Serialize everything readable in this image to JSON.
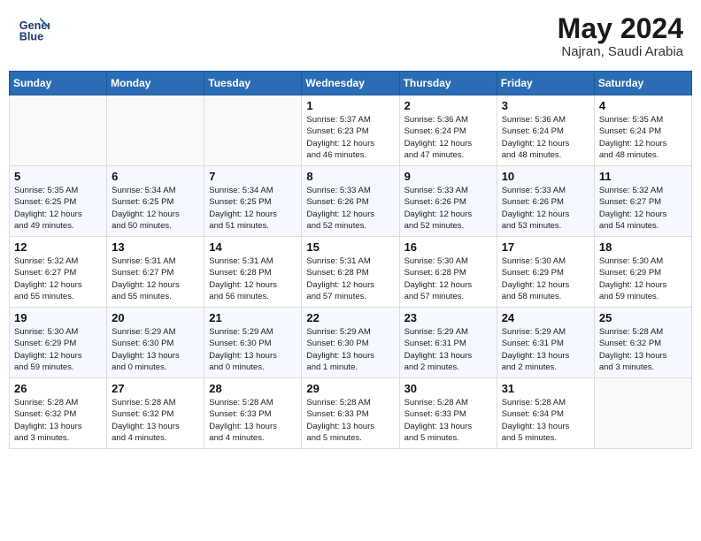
{
  "header": {
    "logo_line1": "General",
    "logo_line2": "Blue",
    "month_title": "May 2024",
    "subtitle": "Najran, Saudi Arabia"
  },
  "weekdays": [
    "Sunday",
    "Monday",
    "Tuesday",
    "Wednesday",
    "Thursday",
    "Friday",
    "Saturday"
  ],
  "weeks": [
    [
      {
        "day": "",
        "info": ""
      },
      {
        "day": "",
        "info": ""
      },
      {
        "day": "",
        "info": ""
      },
      {
        "day": "1",
        "info": "Sunrise: 5:37 AM\nSunset: 6:23 PM\nDaylight: 12 hours\nand 46 minutes."
      },
      {
        "day": "2",
        "info": "Sunrise: 5:36 AM\nSunset: 6:24 PM\nDaylight: 12 hours\nand 47 minutes."
      },
      {
        "day": "3",
        "info": "Sunrise: 5:36 AM\nSunset: 6:24 PM\nDaylight: 12 hours\nand 48 minutes."
      },
      {
        "day": "4",
        "info": "Sunrise: 5:35 AM\nSunset: 6:24 PM\nDaylight: 12 hours\nand 48 minutes."
      }
    ],
    [
      {
        "day": "5",
        "info": "Sunrise: 5:35 AM\nSunset: 6:25 PM\nDaylight: 12 hours\nand 49 minutes."
      },
      {
        "day": "6",
        "info": "Sunrise: 5:34 AM\nSunset: 6:25 PM\nDaylight: 12 hours\nand 50 minutes."
      },
      {
        "day": "7",
        "info": "Sunrise: 5:34 AM\nSunset: 6:25 PM\nDaylight: 12 hours\nand 51 minutes."
      },
      {
        "day": "8",
        "info": "Sunrise: 5:33 AM\nSunset: 6:26 PM\nDaylight: 12 hours\nand 52 minutes."
      },
      {
        "day": "9",
        "info": "Sunrise: 5:33 AM\nSunset: 6:26 PM\nDaylight: 12 hours\nand 52 minutes."
      },
      {
        "day": "10",
        "info": "Sunrise: 5:33 AM\nSunset: 6:26 PM\nDaylight: 12 hours\nand 53 minutes."
      },
      {
        "day": "11",
        "info": "Sunrise: 5:32 AM\nSunset: 6:27 PM\nDaylight: 12 hours\nand 54 minutes."
      }
    ],
    [
      {
        "day": "12",
        "info": "Sunrise: 5:32 AM\nSunset: 6:27 PM\nDaylight: 12 hours\nand 55 minutes."
      },
      {
        "day": "13",
        "info": "Sunrise: 5:31 AM\nSunset: 6:27 PM\nDaylight: 12 hours\nand 55 minutes."
      },
      {
        "day": "14",
        "info": "Sunrise: 5:31 AM\nSunset: 6:28 PM\nDaylight: 12 hours\nand 56 minutes."
      },
      {
        "day": "15",
        "info": "Sunrise: 5:31 AM\nSunset: 6:28 PM\nDaylight: 12 hours\nand 57 minutes."
      },
      {
        "day": "16",
        "info": "Sunrise: 5:30 AM\nSunset: 6:28 PM\nDaylight: 12 hours\nand 57 minutes."
      },
      {
        "day": "17",
        "info": "Sunrise: 5:30 AM\nSunset: 6:29 PM\nDaylight: 12 hours\nand 58 minutes."
      },
      {
        "day": "18",
        "info": "Sunrise: 5:30 AM\nSunset: 6:29 PM\nDaylight: 12 hours\nand 59 minutes."
      }
    ],
    [
      {
        "day": "19",
        "info": "Sunrise: 5:30 AM\nSunset: 6:29 PM\nDaylight: 12 hours\nand 59 minutes."
      },
      {
        "day": "20",
        "info": "Sunrise: 5:29 AM\nSunset: 6:30 PM\nDaylight: 13 hours\nand 0 minutes."
      },
      {
        "day": "21",
        "info": "Sunrise: 5:29 AM\nSunset: 6:30 PM\nDaylight: 13 hours\nand 0 minutes."
      },
      {
        "day": "22",
        "info": "Sunrise: 5:29 AM\nSunset: 6:30 PM\nDaylight: 13 hours\nand 1 minute."
      },
      {
        "day": "23",
        "info": "Sunrise: 5:29 AM\nSunset: 6:31 PM\nDaylight: 13 hours\nand 2 minutes."
      },
      {
        "day": "24",
        "info": "Sunrise: 5:29 AM\nSunset: 6:31 PM\nDaylight: 13 hours\nand 2 minutes."
      },
      {
        "day": "25",
        "info": "Sunrise: 5:28 AM\nSunset: 6:32 PM\nDaylight: 13 hours\nand 3 minutes."
      }
    ],
    [
      {
        "day": "26",
        "info": "Sunrise: 5:28 AM\nSunset: 6:32 PM\nDaylight: 13 hours\nand 3 minutes."
      },
      {
        "day": "27",
        "info": "Sunrise: 5:28 AM\nSunset: 6:32 PM\nDaylight: 13 hours\nand 4 minutes."
      },
      {
        "day": "28",
        "info": "Sunrise: 5:28 AM\nSunset: 6:33 PM\nDaylight: 13 hours\nand 4 minutes."
      },
      {
        "day": "29",
        "info": "Sunrise: 5:28 AM\nSunset: 6:33 PM\nDaylight: 13 hours\nand 5 minutes."
      },
      {
        "day": "30",
        "info": "Sunrise: 5:28 AM\nSunset: 6:33 PM\nDaylight: 13 hours\nand 5 minutes."
      },
      {
        "day": "31",
        "info": "Sunrise: 5:28 AM\nSunset: 6:34 PM\nDaylight: 13 hours\nand 5 minutes."
      },
      {
        "day": "",
        "info": ""
      }
    ]
  ]
}
